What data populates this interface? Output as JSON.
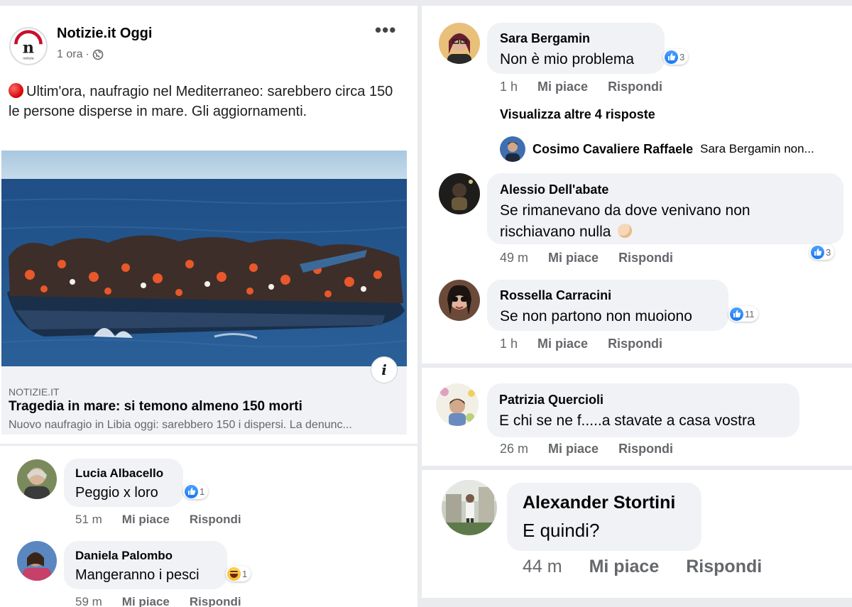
{
  "post": {
    "page_name": "Notizie.it Oggi",
    "time": "1 ora",
    "separator": "·",
    "text": "Ultim'ora, naufragio nel Mediterraneo: sarebbero circa 150 le persone disperse in mare. Gli aggiornamenti.",
    "logo_letter": "n",
    "logo_small_text": "notizie",
    "link": {
      "domain": "NOTIZIE.IT",
      "title": "Tragedia in mare: si temono almeno 150 morti",
      "description": "Nuovo naufragio in Libia oggi: sarebbero 150 i dispersi. La denunc..."
    },
    "info_icon_label": "i",
    "more_options_label": "•••"
  },
  "comments_left": [
    {
      "author": "Lucia Albacello",
      "text": "Peggio x loro",
      "time": "51 m",
      "like": "Mi piace",
      "reply": "Rispondi",
      "reaction": "like",
      "reaction_count": "1"
    },
    {
      "author": "Daniela Palombo",
      "text": "Mangeranno i pesci",
      "time": "59 m",
      "like": "Mi piace",
      "reply": "Rispondi",
      "reaction": "haha",
      "reaction_count": "1"
    }
  ],
  "comments_right": [
    {
      "author": "Sara Bergamin",
      "text": "Non è mio problema",
      "time": "1 h",
      "like": "Mi piace",
      "reply": "Rispondi",
      "reaction": "like",
      "reaction_count": "3"
    },
    {
      "author": "Alessio Dell'abate",
      "text_line1": "Se rimanevano da dove venivano non",
      "text_line2": "rischiavano nulla",
      "time": "49 m",
      "like": "Mi piace",
      "reply": "Rispondi",
      "reaction": "like",
      "reaction_count": "3"
    },
    {
      "author": "Rossella Carracini",
      "text": "Se non partono non muoiono",
      "time": "1 h",
      "like": "Mi piace",
      "reply": "Rispondi",
      "reaction": "like",
      "reaction_count": "11"
    },
    {
      "author": "Patrizia Quercioli",
      "text": "E chi se ne f.....a stavate a casa vostra",
      "time": "26 m",
      "like": "Mi piace",
      "reply": "Rispondi"
    },
    {
      "author": "Alexander Stortini",
      "text": "E quindi?",
      "time": "44 m",
      "like": "Mi piace",
      "reply": "Rispondi"
    }
  ],
  "more_replies": "Visualizza altre 4 risposte",
  "reply_preview": {
    "author": "Cosimo Cavaliere Raffaele",
    "snippet": "Sara Bergamin non..."
  },
  "colors": {
    "like_blue": "#1877f2",
    "bubble": "#f0f2f5",
    "meta_gray": "#65676b",
    "red_dot": "#d40000"
  }
}
